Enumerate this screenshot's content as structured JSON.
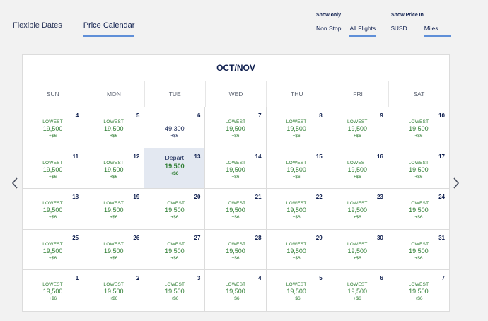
{
  "tabs": [
    {
      "label": "Flexible Dates",
      "active": false
    },
    {
      "label": "Price Calendar",
      "active": true
    }
  ],
  "show_only": {
    "title": "Show only",
    "options": [
      {
        "label": "Non Stop",
        "active": false
      },
      {
        "label": "All Flights",
        "active": true
      }
    ]
  },
  "show_price_in": {
    "title": "Show Price In",
    "options": [
      {
        "label": "$USD",
        "active": false
      },
      {
        "label": "Miles",
        "active": true
      }
    ]
  },
  "calendar": {
    "title": "OCT/NOV",
    "weekdays": [
      "SUN",
      "MON",
      "TUE",
      "WED",
      "THU",
      "FRI",
      "SAT"
    ],
    "days": [
      {
        "day": "4",
        "label": "LOWEST",
        "price": "19,500",
        "tax": "+$6"
      },
      {
        "day": "5",
        "label": "LOWEST",
        "price": "19,500",
        "tax": "+$6"
      },
      {
        "day": "6",
        "label": "",
        "price": "49,300",
        "tax": "+$6"
      },
      {
        "day": "7",
        "label": "LOWEST",
        "price": "19,500",
        "tax": "+$6"
      },
      {
        "day": "8",
        "label": "LOWEST",
        "price": "19,500",
        "tax": "+$6"
      },
      {
        "day": "9",
        "label": "LOWEST",
        "price": "19,500",
        "tax": "+$6"
      },
      {
        "day": "10",
        "label": "LOWEST",
        "price": "19,500",
        "tax": "+$6"
      },
      {
        "day": "11",
        "label": "LOWEST",
        "price": "19,500",
        "tax": "+$6"
      },
      {
        "day": "12",
        "label": "LOWEST",
        "price": "19,500",
        "tax": "+$6"
      },
      {
        "day": "13",
        "label": "Depart",
        "price": "19,500",
        "tax": "+$6",
        "selected": true
      },
      {
        "day": "14",
        "label": "LOWEST",
        "price": "19,500",
        "tax": "+$6"
      },
      {
        "day": "15",
        "label": "LOWEST",
        "price": "19,500",
        "tax": "+$6"
      },
      {
        "day": "16",
        "label": "LOWEST",
        "price": "19,500",
        "tax": "+$6"
      },
      {
        "day": "17",
        "label": "LOWEST",
        "price": "19,500",
        "tax": "+$6"
      },
      {
        "day": "18",
        "label": "LOWEST",
        "price": "19,500",
        "tax": "+$6"
      },
      {
        "day": "19",
        "label": "LOWEST",
        "price": "19,500",
        "tax": "+$6"
      },
      {
        "day": "20",
        "label": "LOWEST",
        "price": "19,500",
        "tax": "+$6"
      },
      {
        "day": "21",
        "label": "LOWEST",
        "price": "19,500",
        "tax": "+$6"
      },
      {
        "day": "22",
        "label": "LOWEST",
        "price": "19,500",
        "tax": "+$6"
      },
      {
        "day": "23",
        "label": "LOWEST",
        "price": "19,500",
        "tax": "+$6"
      },
      {
        "day": "24",
        "label": "LOWEST",
        "price": "19,500",
        "tax": "+$6"
      },
      {
        "day": "25",
        "label": "LOWEST",
        "price": "19,500",
        "tax": "+$6"
      },
      {
        "day": "26",
        "label": "LOWEST",
        "price": "19,500",
        "tax": "+$6"
      },
      {
        "day": "27",
        "label": "LOWEST",
        "price": "19,500",
        "tax": "+$6"
      },
      {
        "day": "28",
        "label": "LOWEST",
        "price": "19,500",
        "tax": "+$6"
      },
      {
        "day": "29",
        "label": "LOWEST",
        "price": "19,500",
        "tax": "+$6"
      },
      {
        "day": "30",
        "label": "LOWEST",
        "price": "19,500",
        "tax": "+$6"
      },
      {
        "day": "31",
        "label": "LOWEST",
        "price": "19,500",
        "tax": "+$6"
      },
      {
        "day": "1",
        "label": "LOWEST",
        "price": "19,500",
        "tax": "+$6"
      },
      {
        "day": "2",
        "label": "LOWEST",
        "price": "19,500",
        "tax": "+$6"
      },
      {
        "day": "3",
        "label": "LOWEST",
        "price": "19,500",
        "tax": "+$6"
      },
      {
        "day": "4",
        "label": "LOWEST",
        "price": "19,500",
        "tax": "+$6"
      },
      {
        "day": "5",
        "label": "LOWEST",
        "price": "19,500",
        "tax": "+$6"
      },
      {
        "day": "6",
        "label": "LOWEST",
        "price": "19,500",
        "tax": "+$6"
      },
      {
        "day": "7",
        "label": "LOWEST",
        "price": "19,500",
        "tax": "+$6"
      }
    ]
  },
  "icons": {
    "prev": "chevron-left-icon",
    "next": "chevron-right-icon"
  },
  "colors": {
    "accent": "#5f8fd8",
    "lowest": "#2e7d32",
    "navy": "#0e1e4e",
    "selected_bg": "#e3e8f1"
  }
}
